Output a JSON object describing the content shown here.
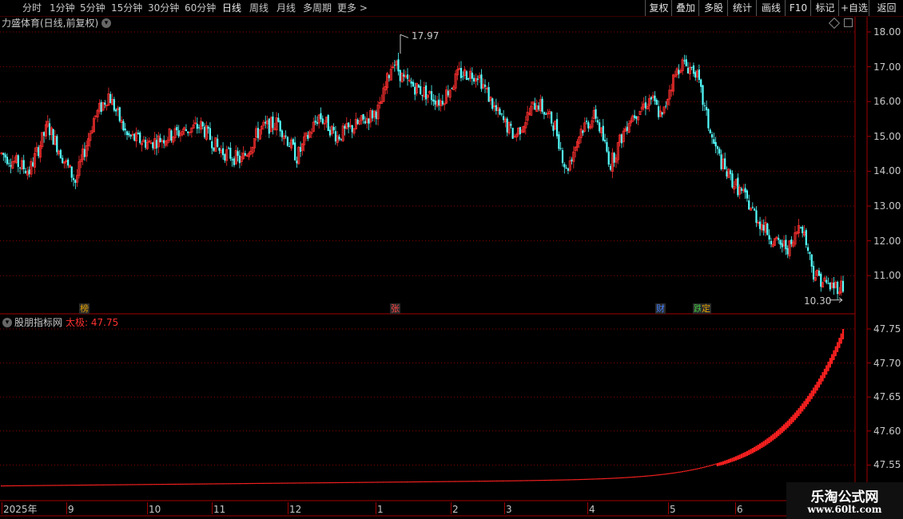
{
  "toolbar": {
    "periods": [
      "分时",
      "1分钟",
      "5分钟",
      "15分钟",
      "30分钟",
      "60分钟",
      "日线",
      "周线",
      "月线",
      "多周期",
      "更多 >"
    ],
    "active_period": "日线",
    "actions": [
      "复权",
      "叠加",
      "多股",
      "统计",
      "画线",
      "F10",
      "标记",
      "+自选",
      "返回"
    ]
  },
  "main_chart": {
    "title": "力盛体育(日线,前复权)",
    "high_label": "17.97",
    "low_label": "10.30",
    "markers": [
      {
        "text": "榜",
        "color": "#e0a000"
      },
      {
        "text": "张",
        "color": "#ff4040"
      },
      {
        "text": "财",
        "color": "#4080ff"
      },
      {
        "text": "跌",
        "color": "#40c040"
      },
      {
        "text": "定",
        "color": "#e0a000"
      }
    ],
    "y_ticks": [
      "18.00",
      "17.00",
      "16.00",
      "15.00",
      "14.00",
      "13.00",
      "12.00",
      "11.00"
    ]
  },
  "indicator": {
    "name": "股朋指标网",
    "label": "太极: 47.75",
    "y_ticks": [
      "47.75",
      "47.70",
      "47.65",
      "47.60",
      "47.55"
    ]
  },
  "x_axis": {
    "labels": [
      "2025年",
      "9",
      "10",
      "11",
      "12",
      "1",
      "2",
      "3",
      "4",
      "5",
      "6"
    ]
  },
  "watermark": {
    "title": "乐淘公式网",
    "url": "www.60lt.com"
  },
  "colors": {
    "up": "#ff3030",
    "down": "#54ffff",
    "grid": "#8b0000",
    "axis": "#a00000",
    "indicator": "#ff2020"
  },
  "chart_data": {
    "type": "candlestick",
    "title": "力盛体育(日线,前复权)",
    "ylim": [
      10.2,
      18.1
    ],
    "max": 17.97,
    "min": 10.3,
    "indicator_series": {
      "name": "太极",
      "last": 47.75,
      "ylim": [
        47.52,
        47.78
      ]
    },
    "x_categories": [
      "2025年",
      "9",
      "10",
      "11",
      "12",
      "1",
      "2",
      "3",
      "4",
      "5",
      "6"
    ]
  }
}
